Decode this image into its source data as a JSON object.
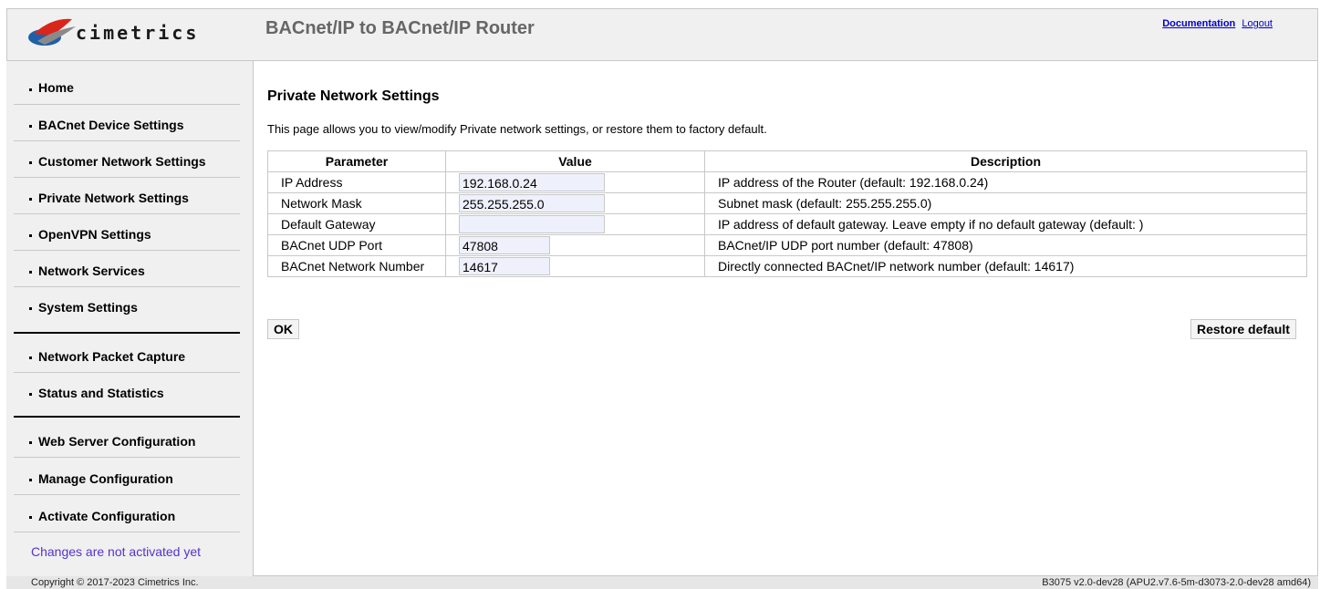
{
  "header": {
    "logo_text": "cimetrics",
    "title": "BACnet/IP to BACnet/IP Router",
    "links": [
      "Documentation",
      "Logout"
    ]
  },
  "sidebar": {
    "items": [
      {
        "label": "Home"
      },
      {
        "label": "BACnet Device Settings"
      },
      {
        "label": "Customer Network Settings"
      },
      {
        "label": "Private Network Settings"
      },
      {
        "label": "OpenVPN Settings"
      },
      {
        "label": "Network Services"
      },
      {
        "label": "System Settings"
      },
      {
        "label": "Network Packet Capture"
      },
      {
        "label": "Status and Statistics"
      },
      {
        "label": "Web Server Configuration"
      },
      {
        "label": "Manage Configuration"
      },
      {
        "label": "Activate Configuration"
      }
    ],
    "changes_notice": "Changes are not activated yet"
  },
  "main": {
    "title": "Private Network Settings",
    "description": "This page allows you to view/modify Private network settings, or restore them to factory default.",
    "table": {
      "headers": [
        "Parameter",
        "Value",
        "Description"
      ],
      "rows": [
        {
          "param": "IP Address",
          "value": "192.168.0.24",
          "desc": "IP address of the Router (default: 192.168.0.24)"
        },
        {
          "param": "Network Mask",
          "value": "255.255.255.0",
          "desc": "Subnet mask (default: 255.255.255.0)"
        },
        {
          "param": "Default Gateway",
          "value": "",
          "desc": "IP address of default gateway. Leave empty if no default gateway (default: )"
        },
        {
          "param": "BACnet UDP Port",
          "value": "47808",
          "desc": "BACnet/IP UDP port number (default: 47808)"
        },
        {
          "param": "BACnet Network Number",
          "value": "14617",
          "desc": "Directly connected BACnet/IP network number (default: 14617)"
        }
      ]
    },
    "ok_label": "OK",
    "restore_label": "Restore default"
  },
  "footer": {
    "copyright": "Copyright © 2017-2023 Cimetrics Inc.",
    "version": "B3075 v2.0-dev28 (APU2.v7.6-5m-d3073-2.0-dev28 amd64)"
  },
  "colors": {
    "header_bg": "#f0f0f0",
    "sidebar_bg": "#f0f0f0",
    "link": "#0000cc",
    "notice": "#5533cc",
    "input_bg": "#eef0fb"
  }
}
